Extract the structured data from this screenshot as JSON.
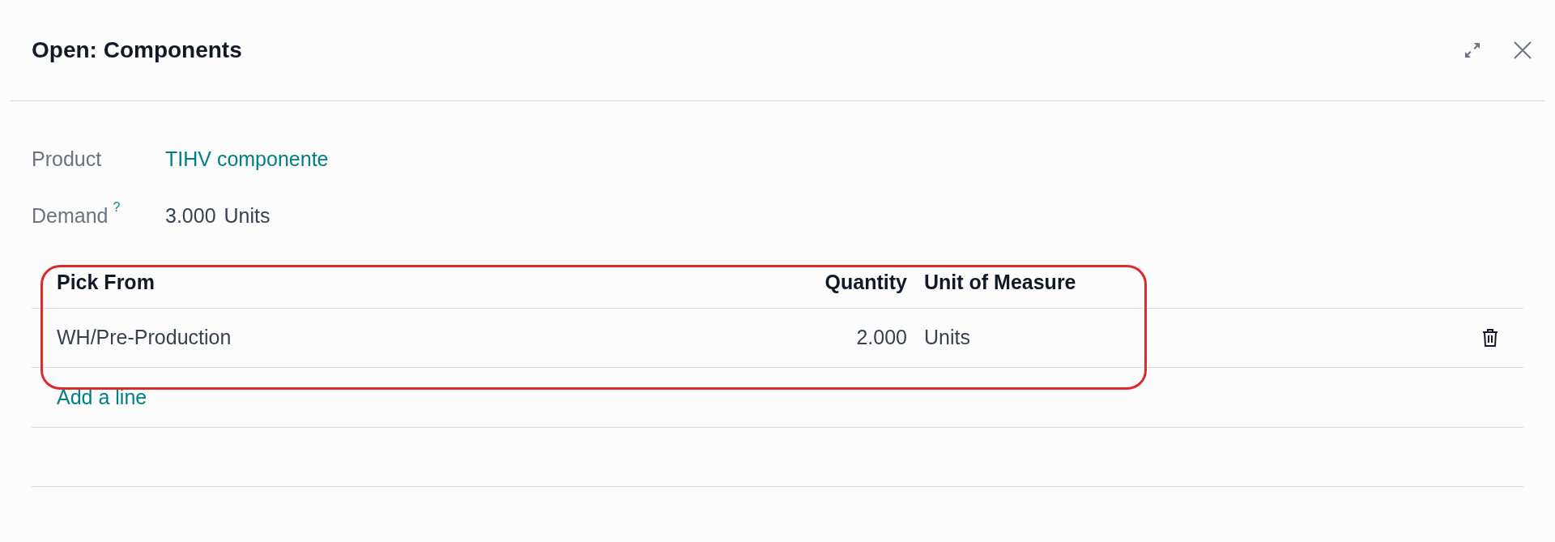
{
  "dialog": {
    "title": "Open: Components"
  },
  "fields": [
    {
      "label": "Product",
      "value": "TIHV componente",
      "kind": "link"
    },
    {
      "label": "Demand",
      "help": "?",
      "value": "3.000",
      "unit": "Units",
      "kind": "quantity"
    }
  ],
  "table": {
    "columns": [
      "Pick From",
      "Quantity",
      "Unit of Measure"
    ],
    "rows": [
      {
        "pick_from": "WH/Pre-Production",
        "quantity": "2.000",
        "unit": "Units"
      }
    ],
    "add_line": "Add a line"
  }
}
